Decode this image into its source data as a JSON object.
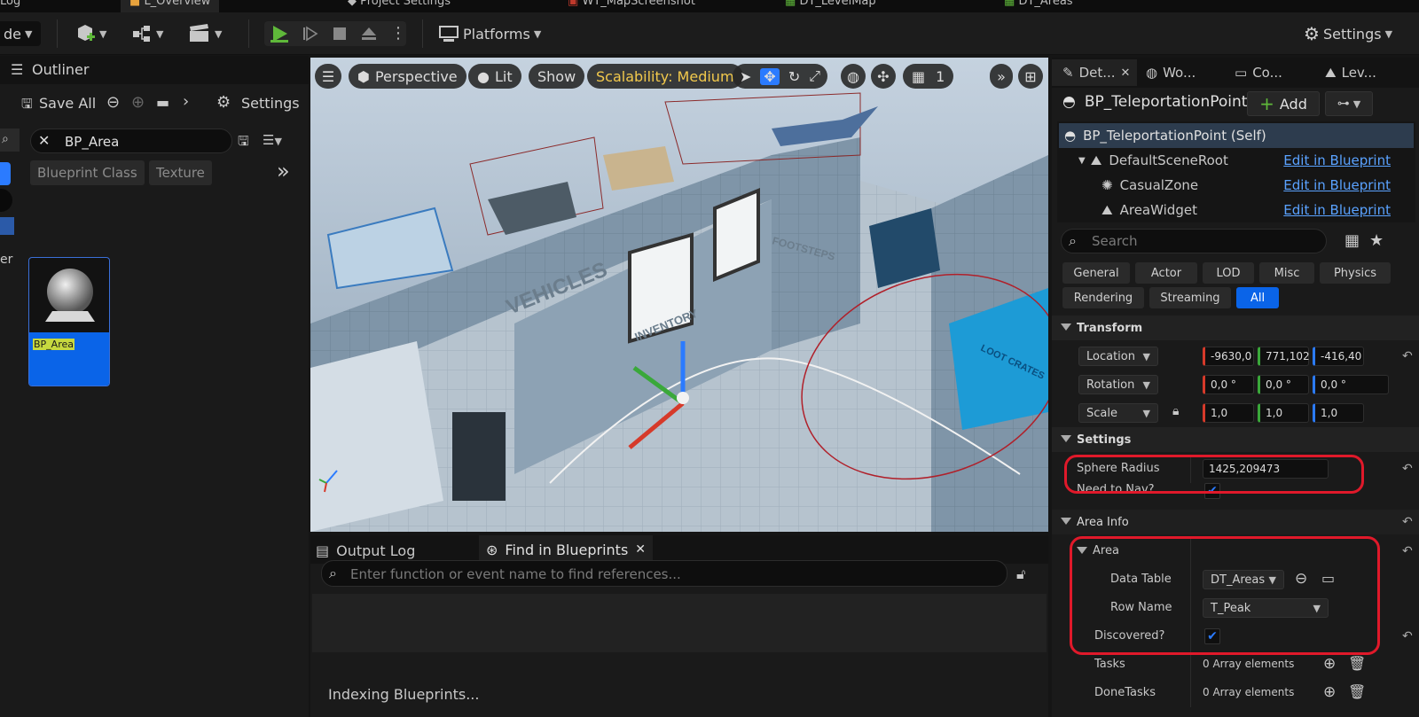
{
  "top_tabs": [
    "Log",
    "L_Overview",
    "Project Settings",
    "WT_MapScreenshot",
    "DT_LevelMap",
    "DT_Areas"
  ],
  "toolbar": {
    "mode_label": "de",
    "platforms_label": "Platforms",
    "settings_label": "Settings"
  },
  "outliner": {
    "tab_label": "Outliner",
    "save_all": "Save All",
    "settings": "Settings",
    "search_value": "BP_Area",
    "filter_chips": [
      "Blueprint Class",
      "Texture"
    ],
    "left_edge_label": "er",
    "asset_name": "BP_Area"
  },
  "viewport": {
    "perspective": "Perspective",
    "lit": "Lit",
    "show": "Show",
    "scalability": "Scalability: Medium",
    "grid_num": "1",
    "scene_texts": {
      "vehicles": "VEHICLES",
      "inventory": "INVENTORY",
      "footsteps": "FOOTSTEPS",
      "loot": "LOOT CRATES"
    }
  },
  "bottom": {
    "tabs": [
      "Output Log",
      "Find in Blueprints"
    ],
    "search_placeholder": "Enter function or event name to find references...",
    "status": "Indexing Blueprints..."
  },
  "details": {
    "tabs": [
      "Det...",
      "Wo...",
      "Co...",
      "Lev..."
    ],
    "actor_name": "BP_TeleportationPoint",
    "add_label": "Add",
    "components": [
      {
        "name": "BP_TeleportationPoint (Self)",
        "link": ""
      },
      {
        "name": "DefaultSceneRoot",
        "link": "Edit in Blueprint"
      },
      {
        "name": "CasualZone",
        "link": "Edit in Blueprint"
      },
      {
        "name": "AreaWidget",
        "link": "Edit in Blueprint"
      }
    ],
    "search_placeholder": "Search",
    "categories_row1": [
      "General",
      "Actor",
      "LOD",
      "Misc",
      "Physics"
    ],
    "categories_row2": [
      "Rendering",
      "Streaming",
      "All"
    ],
    "transform": {
      "section": "Transform",
      "location": {
        "label": "Location",
        "x": "-9630,0",
        "y": "771,102",
        "z": "-416,40"
      },
      "rotation": {
        "label": "Rotation",
        "x": "0,0 °",
        "y": "0,0 °",
        "z": "0,0 °"
      },
      "scale": {
        "label": "Scale",
        "x": "1,0",
        "y": "1,0",
        "z": "1,0"
      }
    },
    "settings": {
      "section": "Settings",
      "sphere_radius_label": "Sphere Radius",
      "sphere_radius_value": "1425,209473",
      "need_nav_label": "Need to Nav?"
    },
    "area_info": {
      "section": "Area Info",
      "area_label": "Area",
      "data_table_label": "Data Table",
      "data_table_value": "DT_Areas",
      "row_name_label": "Row Name",
      "row_name_value": "T_Peak",
      "discovered_label": "Discovered?",
      "tasks_label": "Tasks",
      "tasks_value": "0 Array elements",
      "done_tasks_label": "DoneTasks",
      "done_tasks_value": "0 Array elements"
    }
  },
  "colors": {
    "accent": "#2b7bff",
    "highlight": "#e0192a",
    "link": "#5aa2ff",
    "scalability": "#f2c94c",
    "play": "#5fb83a"
  }
}
